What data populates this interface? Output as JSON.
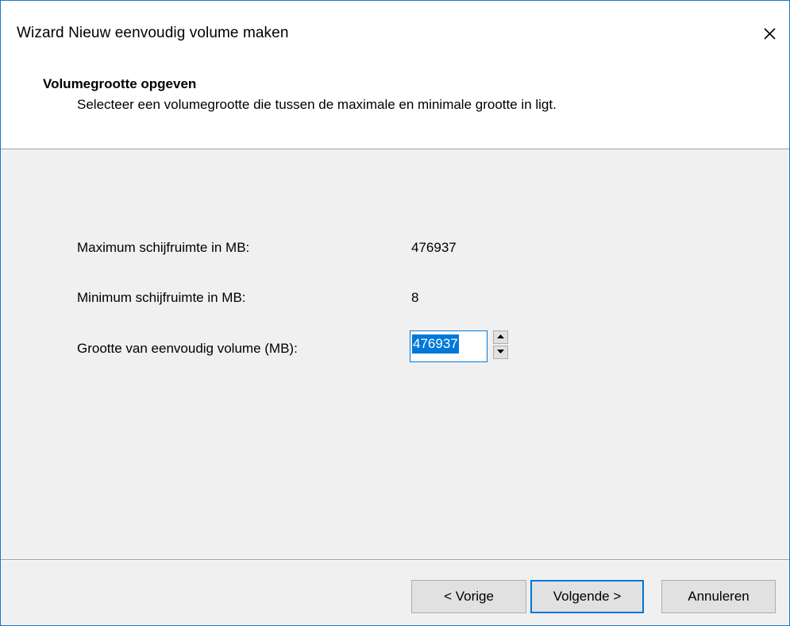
{
  "window": {
    "title": "Wizard Nieuw eenvoudig volume maken",
    "close_icon": "close-icon",
    "accent_color": "#0078d7"
  },
  "header": {
    "title": "Volumegrootte opgeven",
    "subtitle": "Selecteer een volumegrootte die tussen de maximale en minimale grootte in ligt."
  },
  "fields": {
    "max_label": "Maximum schijfruimte in MB:",
    "max_value": "476937",
    "min_label": "Minimum schijfruimte in MB:",
    "min_value": "8",
    "size_label": "Grootte van eenvoudig volume (MB):",
    "size_value": "476937"
  },
  "buttons": {
    "back": "< Vorige",
    "next": "Volgende >",
    "cancel": "Annuleren"
  }
}
